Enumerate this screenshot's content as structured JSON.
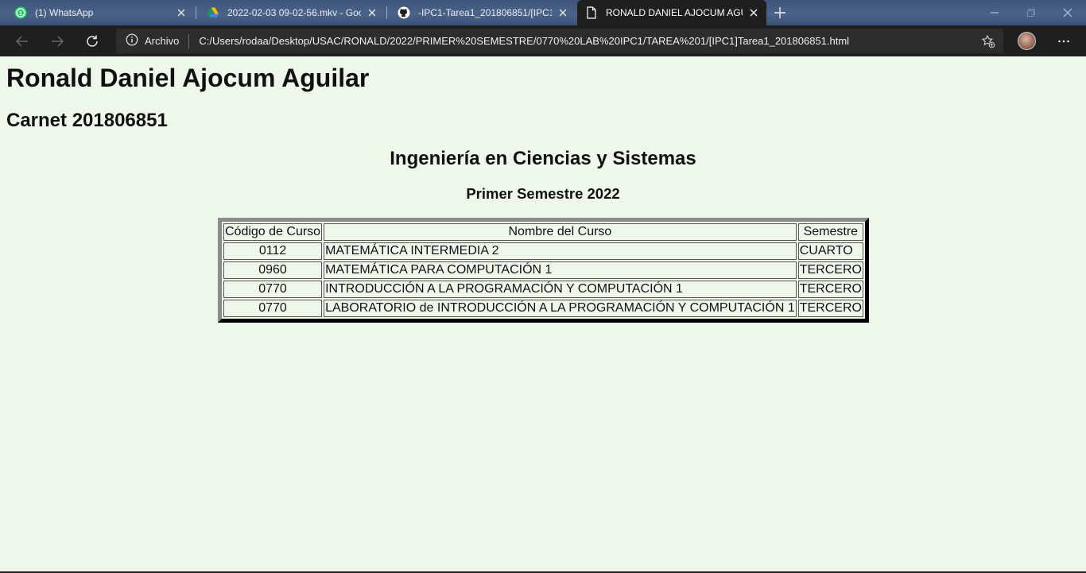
{
  "browser": {
    "tabs": [
      {
        "title": "(1) WhatsApp",
        "icon": "whatsapp-icon",
        "active": false
      },
      {
        "title": "2022-02-03 09-02-56.mkv - Goo",
        "icon": "google-drive-icon",
        "active": false
      },
      {
        "title": "-IPC1-Tarea1_201806851/[IPC1]T",
        "icon": "github-icon",
        "active": false
      },
      {
        "title": "RONALD DANIEL AJOCUM AGUI",
        "icon": "file-icon",
        "active": true
      }
    ],
    "site_info_label": "Archivo",
    "url": "C:/Users/rodaa/Desktop/USAC/RONALD/2022/PRIMER%20SEMESTRE/0770%20LAB%20IPC1/TAREA%201/[IPC1]Tarea1_201806851.html"
  },
  "page": {
    "name": "Ronald Daniel Ajocum Aguilar",
    "carnet": "Carnet 201806851",
    "career": "Ingeniería en Ciencias y Sistemas",
    "semester": "Primer Semestre 2022",
    "table": {
      "headers": [
        "Código de Curso",
        "Nombre del Curso",
        "Semestre"
      ],
      "rows": [
        [
          "0112",
          "MATEMÁTICA INTERMEDIA 2",
          "CUARTO"
        ],
        [
          "0960",
          "MATEMÁTICA PARA COMPUTACIÓN 1",
          "TERCERO"
        ],
        [
          "0770",
          "INTRODUCCIÓN A LA PROGRAMACIÓN Y COMPUTACIÓN 1",
          "TERCERO"
        ],
        [
          "0770",
          "LABORATORIO de INTRODUCCIÓN A LA PROGRAMACIÓN Y COMPUTACIÓN 1",
          "TERCERO"
        ]
      ]
    }
  },
  "colors": {
    "page_background": "#eef8ea",
    "toolbar_background": "#1f1f1f",
    "tabstrip_background": "#4a6388"
  }
}
